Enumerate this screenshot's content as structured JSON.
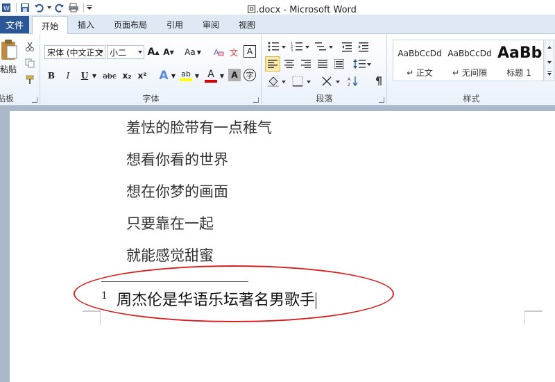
{
  "window": {
    "title": "回.docx  -  Microsoft Word"
  },
  "tabs": {
    "file": "文件",
    "home": "开始",
    "insert": "插入",
    "layout": "页面布局",
    "references": "引用",
    "review": "审阅",
    "view": "视图"
  },
  "clipboard": {
    "paste": "粘贴",
    "group_label": "剪贴板"
  },
  "font": {
    "name": "宋体 (中文正文",
    "size": "小二",
    "aa_label": "Aa",
    "group_label": "字体",
    "bold": "B",
    "italic": "I",
    "underline": "U",
    "strike": "abc",
    "subscript": "x₂",
    "superscript": "x²",
    "char_shading": "A",
    "char_border": "字",
    "grow": "A",
    "shrink": "A",
    "highlight": "ab",
    "font_color": "A",
    "effects": "A",
    "phonetic": "文",
    "clear": "A"
  },
  "paragraph": {
    "group_label": "段落"
  },
  "styles": {
    "group_label": "样式",
    "items": [
      {
        "sample": "AaBbCcDd",
        "name": "↵ 正文"
      },
      {
        "sample": "AaBbCcDd",
        "name": "↵ 无间隔"
      },
      {
        "sample": "AaBb",
        "name": "标题 1"
      }
    ]
  },
  "document": {
    "lines": [
      "羞怯的脸带有一点稚气",
      "想看你看的世界",
      "想在你梦的画面",
      "只要靠在一起",
      "就能感觉甜蜜"
    ],
    "footnote_number": "1",
    "footnote_text": "周杰伦是华语乐坛著名男歌手"
  },
  "colors": {
    "accent": "#2b5797",
    "annotation": "#d62020",
    "highlight": "#ffff00",
    "font_color": "#e00000"
  }
}
